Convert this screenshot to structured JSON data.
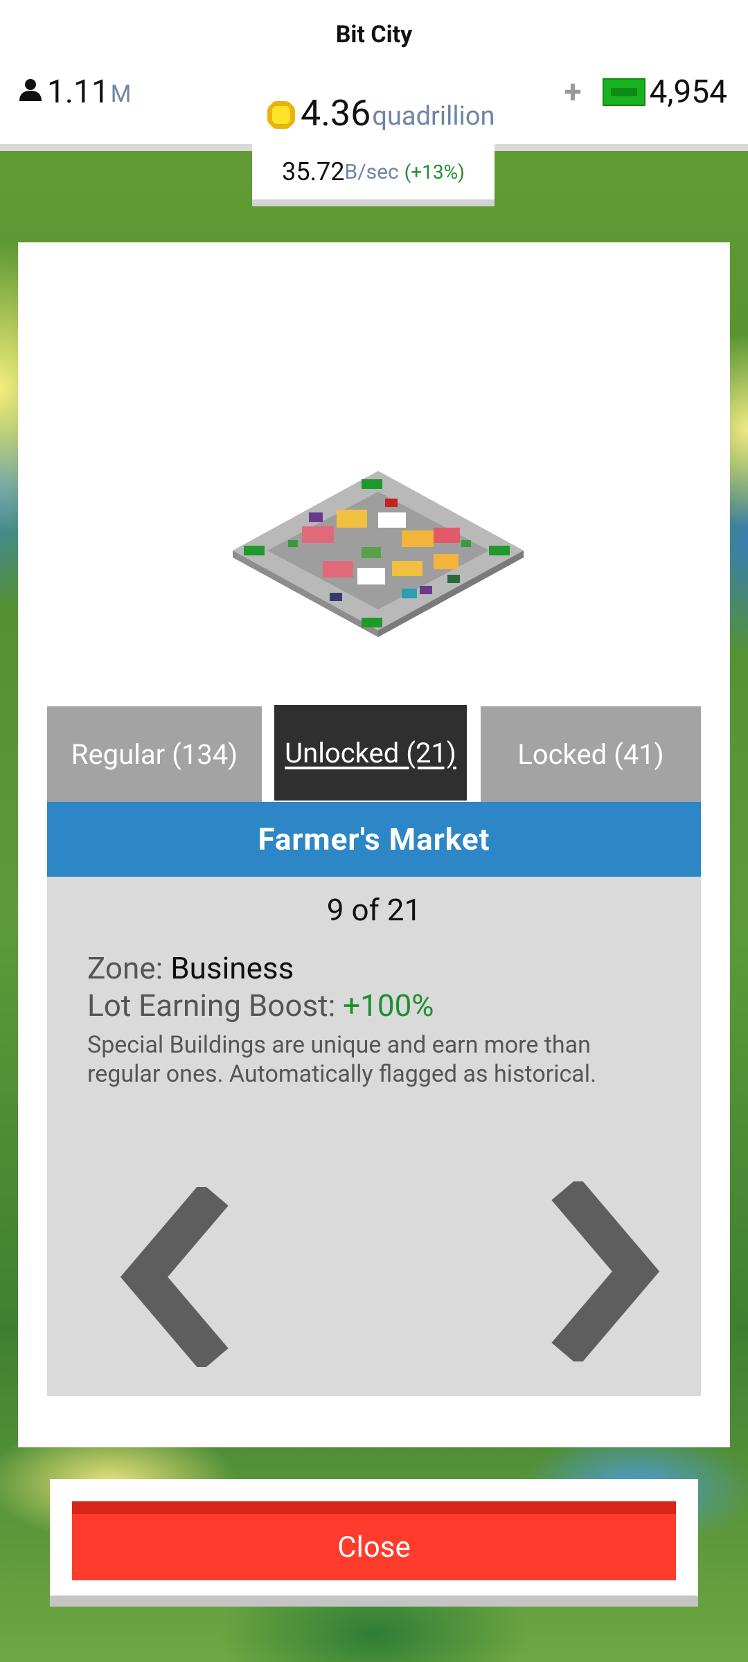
{
  "header": {
    "title": "Bit City",
    "population": {
      "value": "1.11",
      "unit": "M",
      "icon": "person-icon"
    },
    "coins": {
      "value": "4.36",
      "unit": "quadrillion",
      "icon": "coin-icon"
    },
    "cash": {
      "plus": "+",
      "value": "4,954",
      "icon": "cash-icon"
    },
    "rate": {
      "value": "35.72",
      "unit": "B/sec",
      "change": "(+13%)"
    }
  },
  "tabs": [
    {
      "label": "Regular (134)",
      "active": false
    },
    {
      "label": "Unlocked (21)",
      "active": true
    },
    {
      "label": "Locked (41)",
      "active": false
    }
  ],
  "building": {
    "name": "Farmer's Market",
    "counter": "9 of 21",
    "zone_label": "Zone: ",
    "zone_value": "Business",
    "boost_label": "Lot Earning Boost: ",
    "boost_value": "+100%",
    "description": "Special Buildings are unique and earn more than regular ones. Automatically flagged as historical."
  },
  "close_label": "Close",
  "colors": {
    "accent_blue": "#2d86c6",
    "active_tab": "#2f2f2f",
    "inactive_tab": "#a3a3a3",
    "positive_green": "#1f8f2e",
    "close_red": "#ff3b2b",
    "unit_blue_gray": "#6e84a8"
  }
}
